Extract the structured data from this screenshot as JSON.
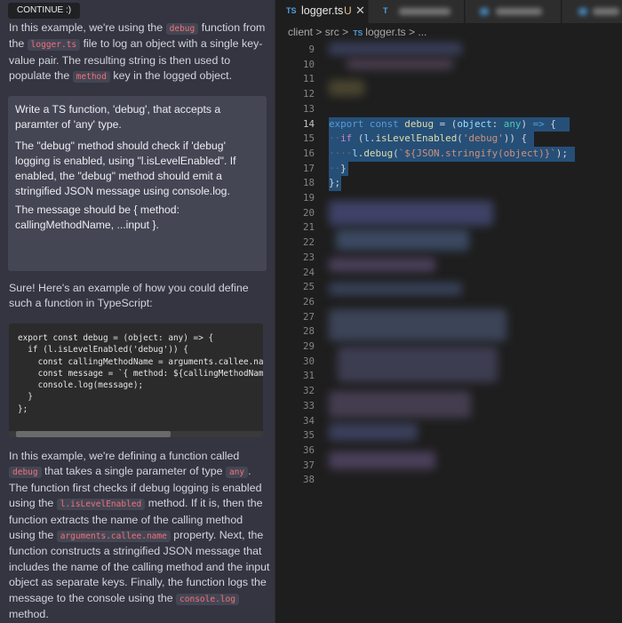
{
  "chat": {
    "continue_label": "CONTINUE :)",
    "intro": {
      "p1": "In this example, we're using the",
      "c1": "debug",
      "p2": " function from the ",
      "c2": "logger.ts",
      "p3": " file to log an object with a single key-value pair. The resulting string is then used to populate the ",
      "c3": "method",
      "p4": " key in the logged object."
    },
    "prompt": {
      "line1": "Write a TS function, 'debug', that accepts a paramter of 'any' type.",
      "line2": "The \"debug\" method should check if 'debug' logging is enabled, using \"l.isLevelEnabled\". If enabled, the \"debug\" method should emit a stringified JSON message using console.log.",
      "line3": "The message should be { method: callingMethodName, ...input }."
    },
    "answer_intro": "Sure! Here's an example of how you could define such a function in TypeScript:",
    "code_snippet": "export const debug = (object: any) => {\n  if (l.isLevelEnabled('debug')) {\n    const callingMethodName = arguments.callee.name;\n    const message = `{ method: ${callingMethodName},\n    console.log(message);\n  }\n};",
    "explanation": {
      "p1": "In this example, we're defining a function called ",
      "c1": "debug",
      "p2": " that takes a single parameter of type ",
      "c2": "any",
      "p3": ". The function first checks if debug logging is enabled using the ",
      "c3": "l.isLevelEnabled",
      "p4": " method. If it is, then the function extracts the name of the calling method using the ",
      "c4": "arguments.callee.name",
      "p5": " property. Next, the function constructs a stringified JSON message that includes the name of the calling method and the input object as separate keys. Finally, the function logs the message to the console using the ",
      "c5": "console.log",
      "p6": " method."
    }
  },
  "editor": {
    "tab": {
      "badge": "TS",
      "label": "logger.ts",
      "status": "U",
      "close": "✕"
    },
    "breadcrumb": {
      "folder1": "client",
      "sep": ">",
      "folder2": "src",
      "badge": "TS",
      "file": "logger.ts",
      "more": "..."
    },
    "line_numbers": [
      "9",
      "10",
      "11",
      "12",
      "13",
      "14",
      "15",
      "16",
      "17",
      "18",
      "19",
      "20",
      "21",
      "22",
      "23",
      "24",
      "25",
      "26",
      "27",
      "28",
      "29",
      "30",
      "31",
      "32",
      "33",
      "34",
      "35",
      "36",
      "37",
      "38"
    ],
    "active_line": "14",
    "code": {
      "l14": {
        "kw1": "export",
        "kw2": "const",
        "name": "debug",
        "eq": "=",
        "open": "(",
        "param": "object",
        "colon": ":",
        "type": "any",
        "close": ")",
        "arrow": "=>",
        "brace": "{"
      },
      "l15": {
        "indent": "··",
        "kw": "if",
        "open": "(",
        "obj": "l",
        "dot": ".",
        "fn": "isLevelEnabled",
        "p1": "(",
        "str": "'debug'",
        "p2": "))",
        "brace": "{"
      },
      "l16": {
        "indent": "····",
        "obj": "l",
        "dot": ".",
        "fn": "debug",
        "open": "(",
        "str": "`${JSON.stringify(object)}`",
        "close": ");"
      },
      "l17": {
        "indent": "··",
        "brace": "}"
      },
      "l18": {
        "brace": "};"
      }
    }
  },
  "colors": {
    "chat_bg": "#343541",
    "editor_bg": "#1e1e1e",
    "selection": "#264f78",
    "keyword": "#569cd6",
    "string": "#ce9178",
    "function": "#dcdcaa",
    "variable": "#9cdcfe"
  }
}
